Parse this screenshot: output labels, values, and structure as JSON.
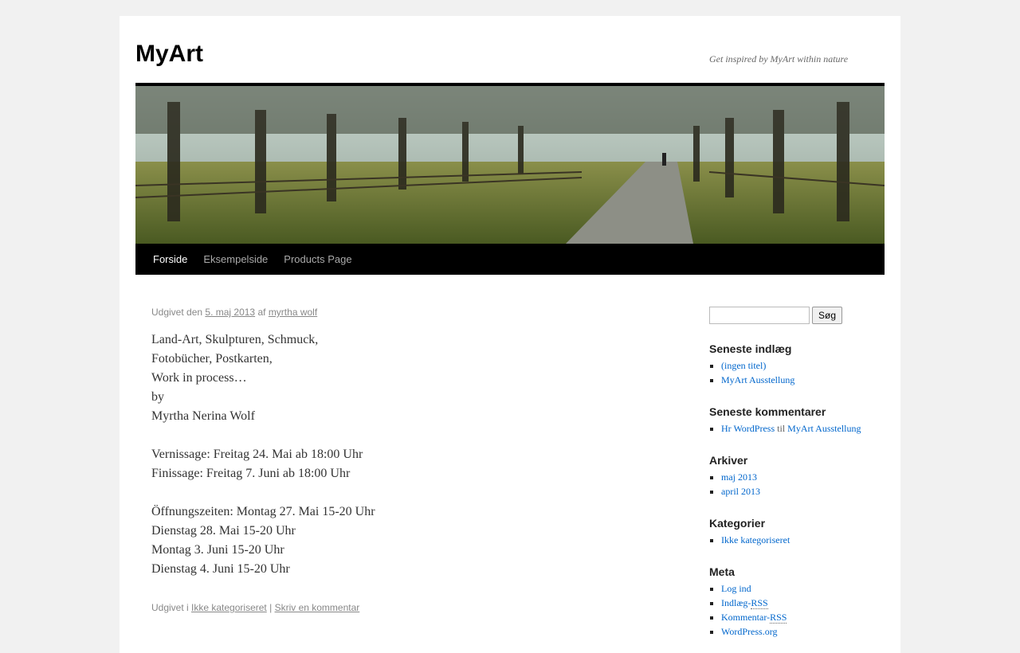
{
  "site": {
    "title": "MyArt",
    "description": "Get inspired by MyArt within nature"
  },
  "nav": {
    "items": [
      {
        "label": "Forside",
        "current": true
      },
      {
        "label": "Eksempelside",
        "current": false
      },
      {
        "label": "Products Page",
        "current": false
      }
    ]
  },
  "post": {
    "meta": {
      "prefix": "Udgivet den",
      "date": "5. maj 2013",
      "by": "af",
      "author": "myrtha wolf"
    },
    "paragraphs": [
      [
        "Land-Art, Skulpturen, Schmuck,",
        "Fotobücher, Postkarten,",
        "Work in process…",
        "by",
        "Myrtha Nerina Wolf"
      ],
      [
        "Vernissage: Freitag 24. Mai ab 18:00 Uhr",
        "Finissage: Freitag 7. Juni ab 18:00 Uhr"
      ],
      [
        "Öffnungszeiten: Montag 27. Mai 15-20 Uhr",
        "Dienstag 28. Mai 15-20 Uhr",
        "Montag 3. Juni 15-20 Uhr",
        "Dienstag 4. Juni 15-20 Uhr"
      ]
    ],
    "utility": {
      "prefix": "Udgivet i",
      "category": "Ikke kategoriseret",
      "separator": "|",
      "comment": "Skriv en kommentar"
    }
  },
  "sidebar": {
    "search": {
      "value": "",
      "button": "Søg"
    },
    "recent_posts": {
      "title": "Seneste indlæg",
      "items": [
        "(ingen titel)",
        "MyArt Ausstellung"
      ]
    },
    "recent_comments": {
      "title": "Seneste kommentarer",
      "author": "Hr WordPress",
      "joiner": "til",
      "post": "MyArt Ausstellung"
    },
    "archives": {
      "title": "Arkiver",
      "items": [
        "maj 2013",
        "april 2013"
      ]
    },
    "categories": {
      "title": "Kategorier",
      "items": [
        "Ikke kategoriseret"
      ]
    },
    "meta": {
      "title": "Meta",
      "login": "Log ind",
      "posts_rss_prefix": "Indlæg-",
      "comments_rss_prefix": "Kommentar-",
      "rss": "RSS",
      "wordpress": "WordPress.org"
    }
  },
  "colors": {
    "link": "#0066cc",
    "nav_bg": "#000000",
    "page_bg": "#f1f1f1"
  }
}
